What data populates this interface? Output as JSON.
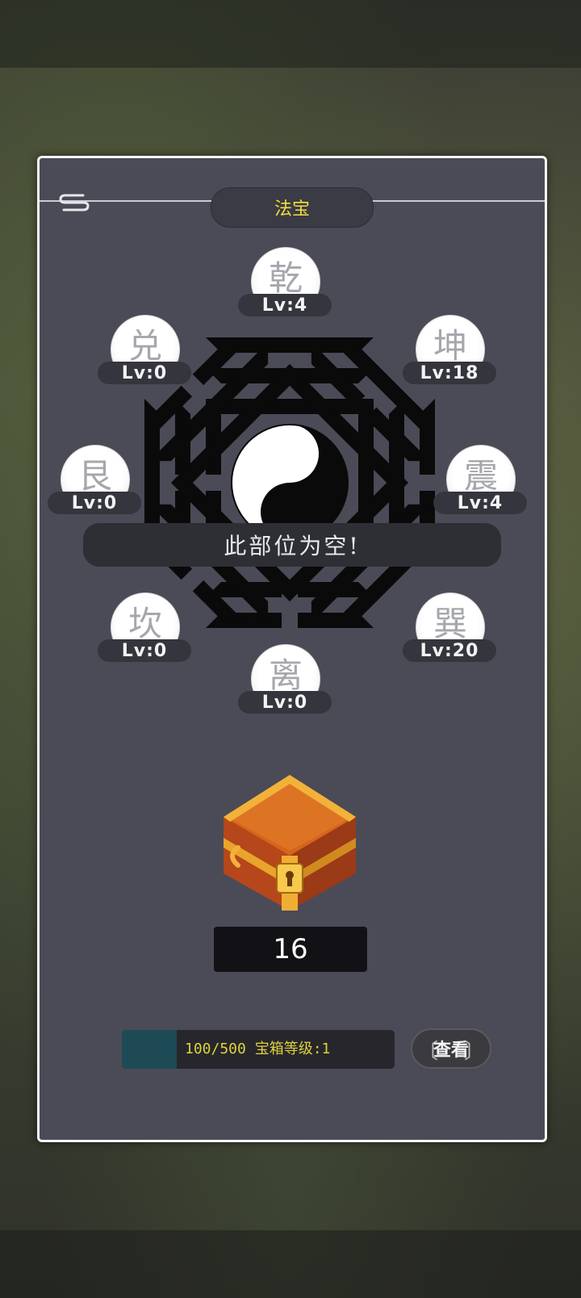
{
  "header": {
    "title": "法宝"
  },
  "nodes": [
    {
      "glyph": "乾",
      "level": "Lv:4"
    },
    {
      "glyph": "兑",
      "level": "Lv:0"
    },
    {
      "glyph": "坤",
      "level": "Lv:18"
    },
    {
      "glyph": "艮",
      "level": "Lv:0"
    },
    {
      "glyph": "震",
      "level": "Lv:4"
    },
    {
      "glyph": "坎",
      "level": "Lv:0"
    },
    {
      "glyph": "巽",
      "level": "Lv:20"
    },
    {
      "glyph": "离",
      "level": "Lv:0"
    }
  ],
  "status_message": "此部位为空!",
  "chest": {
    "count": "16"
  },
  "progress": {
    "text": "100/500 宝箱等级:1",
    "current": 100,
    "max": 500
  },
  "buttons": {
    "view_label": "查看"
  },
  "colors": {
    "accent_title": "#f2dd3b",
    "progress_text": "#ded13b",
    "progress_fill": "#1d4a55",
    "panel": "#4a4b57"
  },
  "icons": {
    "back": "scroll-back-icon",
    "center": "taiji-icon",
    "chest": "treasure-chest-icon"
  }
}
